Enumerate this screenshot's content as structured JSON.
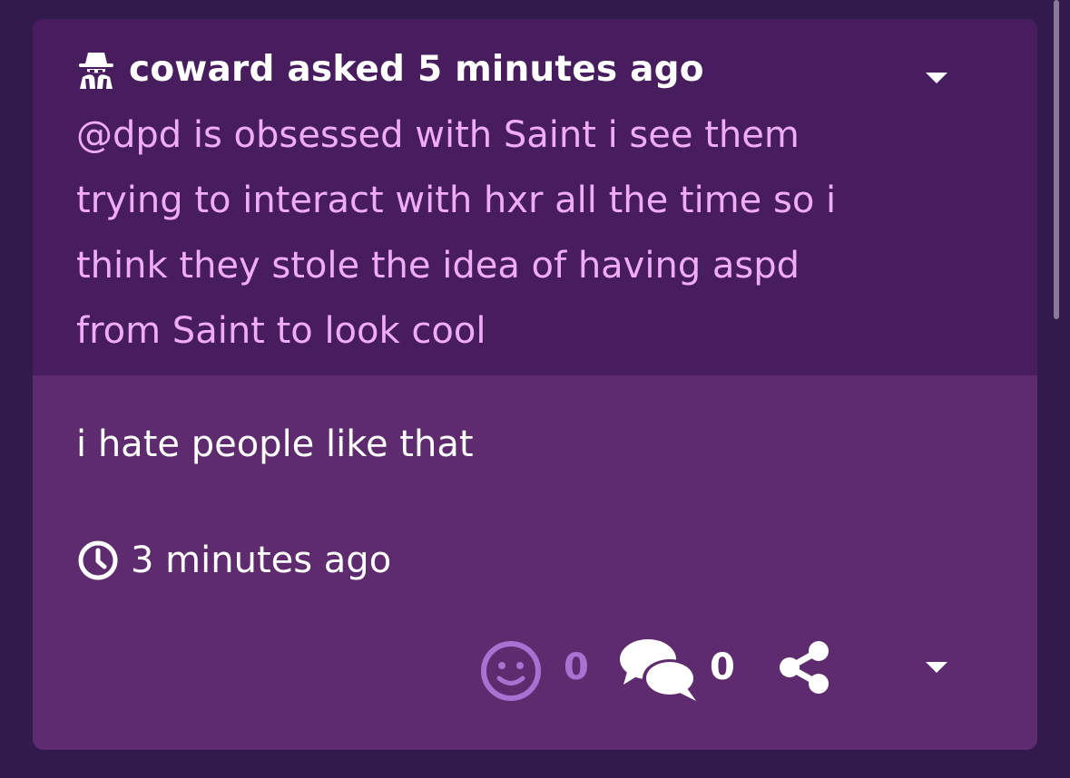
{
  "question": {
    "author_line": "coward asked 5 minutes ago",
    "body": "@dpd is obsessed with Saint i see them trying to interact with hxr all the time so i think they stole the idea of having aspd from Saint to look cool",
    "author_icon": "spy-icon",
    "menu_icon": "caret-down-icon"
  },
  "answer": {
    "text": "i hate people like that",
    "timestamp": "3 minutes ago",
    "timestamp_icon": "clock-icon"
  },
  "actions": {
    "reaction_count": "0",
    "comment_count": "0",
    "reaction_icon": "smile-icon",
    "comment_icon": "comments-icon",
    "share_icon": "share-icon",
    "menu_icon": "caret-down-icon"
  },
  "colors": {
    "page_background": "#321a4c",
    "question_background": "#471d5e",
    "answer_background": "#5e2c6e",
    "question_text": "#f0acf8",
    "reaction_accent": "#a872d2",
    "primary_text": "#ffffff"
  }
}
